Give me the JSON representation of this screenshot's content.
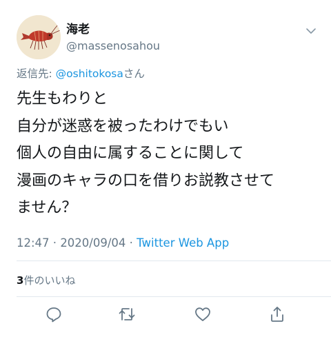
{
  "author": {
    "display_name": "海老",
    "handle": "@massenosahou"
  },
  "reply": {
    "prefix": "返信先: ",
    "mention": "@oshitokosa",
    "suffix": "さん"
  },
  "tweet": {
    "lines": [
      "先生もわりと",
      "自分が迷惑を被ったわけでもい",
      "個人の自由に属することに関して",
      "漫画のキャラの口を借りお説教させて",
      "ません？"
    ]
  },
  "meta": {
    "time": "12:47",
    "separator1": " · ",
    "date": "2020/09/04",
    "separator2": " · ",
    "source": "Twitter Web App"
  },
  "likes": {
    "count": "3",
    "label": "件のいいね"
  },
  "icons": {
    "avatar": "shrimp-illustration",
    "menu": "chevron-down-icon",
    "actions": [
      "reply-icon",
      "retweet-icon",
      "like-icon",
      "share-icon"
    ]
  },
  "colors": {
    "link": "#1b95e0",
    "secondary_text": "#657786",
    "primary_text": "#14171a",
    "divider": "#e1e8ed"
  }
}
